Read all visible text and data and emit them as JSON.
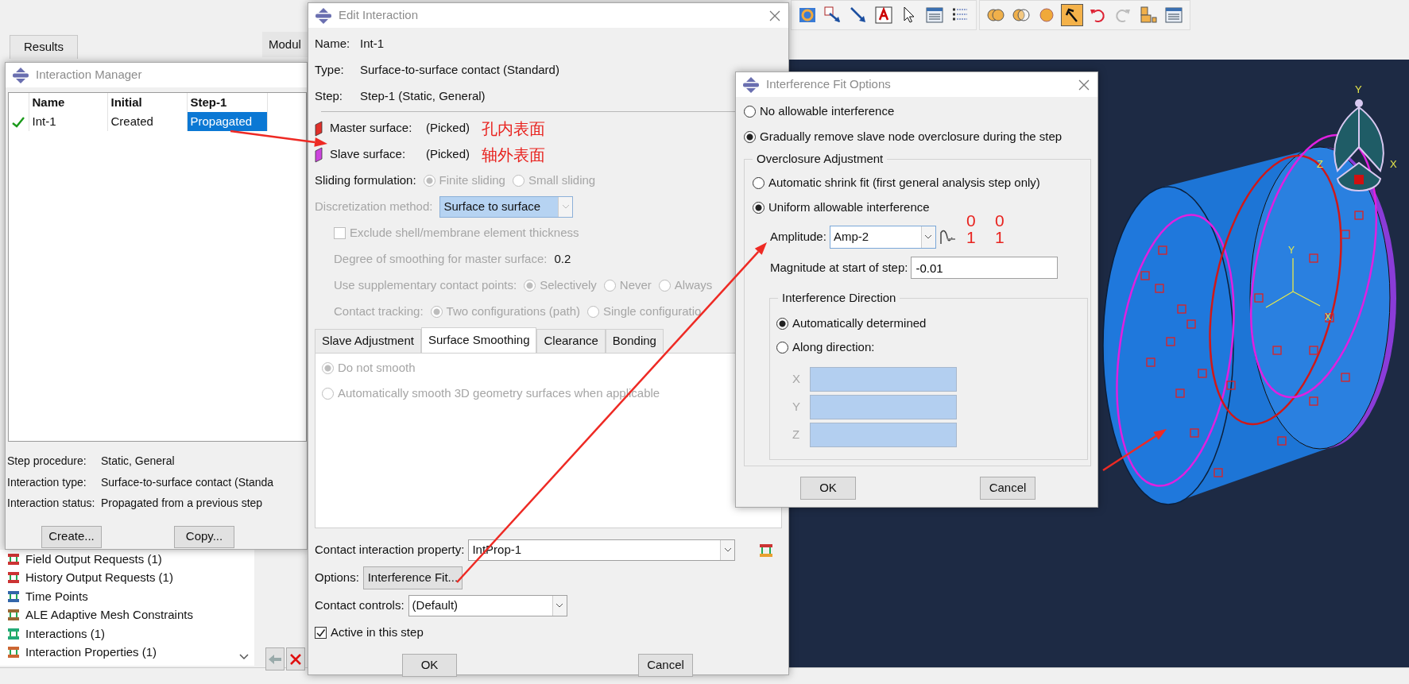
{
  "workspace": {
    "tabs": [
      {
        "label": "Results",
        "selected": false
      }
    ],
    "module_label": "Modul"
  },
  "toolbar": {
    "groups": [
      {
        "tools": [
          {
            "kind": "ring",
            "pressed": false
          },
          {
            "kind": "text-arrow",
            "pressed": false
          },
          {
            "kind": "arrow",
            "pressed": false
          },
          {
            "kind": "text-box",
            "pressed": false
          },
          {
            "kind": "pointer",
            "pressed": false
          },
          {
            "kind": "table",
            "pressed": false
          },
          {
            "kind": "list",
            "pressed": false
          }
        ]
      },
      {
        "tools": [
          {
            "kind": "union",
            "pressed": false
          },
          {
            "kind": "intersect",
            "pressed": false
          },
          {
            "kind": "sphere",
            "pressed": false
          },
          {
            "kind": "pick",
            "pressed": true
          },
          {
            "kind": "undo",
            "pressed": false
          },
          {
            "kind": "redo",
            "pressed": false
          },
          {
            "kind": "blocks",
            "pressed": false
          },
          {
            "kind": "table",
            "pressed": false
          }
        ]
      }
    ]
  },
  "interaction_manager": {
    "title": "Interaction Manager",
    "columns": [
      "Name",
      "Initial",
      "Step-1"
    ],
    "rows": [
      {
        "valid": true,
        "cells": [
          {
            "text": "Int-1",
            "selected": false
          },
          {
            "text": "Created",
            "selected": false
          },
          {
            "text": "Propagated",
            "selected": true
          }
        ]
      }
    ],
    "details": [
      {
        "label": "Step procedure:",
        "value": "Static, General"
      },
      {
        "label": "Interaction type:",
        "value": "Surface-to-surface contact (Standa"
      },
      {
        "label": "Interaction status:",
        "value": "Propagated from a previous step"
      }
    ],
    "buttons": [
      "Create...",
      "Copy..."
    ]
  },
  "model_tree": {
    "items": [
      {
        "kind": "field-output",
        "label": "Field Output Requests (1)"
      },
      {
        "kind": "history-output",
        "label": "History Output Requests (1)"
      },
      {
        "kind": "time-points",
        "label": "Time Points"
      },
      {
        "kind": "ale",
        "label": "ALE Adaptive Mesh Constraints"
      },
      {
        "kind": "interactions",
        "label": "Interactions (1)"
      },
      {
        "kind": "interaction-properties",
        "label": "Interaction Properties (1)"
      }
    ]
  },
  "edit_interaction": {
    "title": "Edit Interaction",
    "info": [
      {
        "label": "Name:",
        "value": "Int-1"
      },
      {
        "label": "Type:",
        "value": "Surface-to-surface contact (Standard)"
      },
      {
        "label": "Step:",
        "value": "Step-1 (Static, General)"
      }
    ],
    "surfaces": [
      {
        "label": "Master surface:",
        "value": "(Picked)",
        "color": "#e0302a",
        "note": "孔内表面"
      },
      {
        "label": "Slave surface:",
        "value": "(Picked)",
        "color": "#cc44dd",
        "note": "轴外表面"
      }
    ],
    "settings": [
      {
        "kind": "radio",
        "label": "Sliding formulation:",
        "disabled": false,
        "options": [
          {
            "label": "Finite sliding",
            "selected": true,
            "disabled": true
          },
          {
            "label": "Small sliding",
            "selected": false,
            "disabled": true
          }
        ]
      },
      {
        "kind": "select",
        "label": "Discretization method:",
        "disabled": true,
        "value": "Surface to surface",
        "children": [
          {
            "kind": "checkbox",
            "label": "Exclude shell/membrane element thickness",
            "checked": false,
            "disabled": true
          },
          {
            "kind": "value",
            "label": "Degree of smoothing for master surface:",
            "value": "0.2",
            "disabled": true
          },
          {
            "kind": "radio",
            "label": "Use supplementary contact points:",
            "disabled": true,
            "options": [
              {
                "label": "Selectively",
                "selected": true,
                "disabled": true
              },
              {
                "label": "Never",
                "selected": false,
                "disabled": true
              },
              {
                "label": "Always",
                "selected": false,
                "disabled": true
              }
            ]
          },
          {
            "kind": "radio",
            "label": "Contact tracking:",
            "disabled": true,
            "options": [
              {
                "label": "Two configurations (path)",
                "selected": true,
                "disabled": true
              },
              {
                "label": "Single configuratio",
                "selected": false,
                "disabled": true
              }
            ]
          }
        ]
      }
    ],
    "tabs": [
      {
        "label": "Slave Adjustment",
        "selected": false
      },
      {
        "label": "Surface Smoothing",
        "selected": true
      },
      {
        "label": "Clearance",
        "selected": false
      },
      {
        "label": "Bonding",
        "selected": false
      }
    ],
    "tab_options": [
      {
        "label": "Do not smooth",
        "selected": true,
        "disabled": true
      },
      {
        "label": "Automatically smooth 3D geometry surfaces when applicable",
        "selected": false,
        "disabled": true
      }
    ],
    "property": {
      "label": "Contact interaction property:",
      "value": "IntProp-1"
    },
    "options": {
      "label": "Options:",
      "button": "Interference Fit..."
    },
    "controls": {
      "label": "Contact controls:",
      "value": "(Default)"
    },
    "active": {
      "label": "Active in this step",
      "checked": true
    },
    "buttons": [
      "OK",
      "Cancel"
    ]
  },
  "interference_fit": {
    "title": "Interference Fit Options",
    "modes": [
      {
        "label": "No allowable interference",
        "selected": false
      },
      {
        "label": "Gradually remove slave node overclosure during the step",
        "selected": true
      }
    ],
    "overclosure": {
      "title": "Overclosure Adjustment",
      "methods": [
        {
          "label": "Automatic shrink fit (first general analysis step only)",
          "selected": false
        },
        {
          "label": "Uniform allowable interference",
          "selected": true
        }
      ],
      "amplitude": {
        "label": "Amplitude:",
        "value": "Amp-2"
      },
      "marks": [
        "0",
        "0",
        "1",
        "1"
      ],
      "magnitude": {
        "label": "Magnitude at start of step:",
        "value": "-0.01"
      },
      "direction": {
        "title": "Interference Direction",
        "options": [
          {
            "label": "Automatically determined",
            "selected": true
          },
          {
            "label": "Along direction:",
            "selected": false
          }
        ],
        "components": [
          {
            "label": "X",
            "disabled": true
          },
          {
            "label": "Y",
            "disabled": true
          },
          {
            "label": "Z",
            "disabled": true
          }
        ]
      }
    },
    "buttons": [
      "OK",
      "Cancel"
    ]
  },
  "viewport": {
    "triad": [
      "Y",
      "Z",
      "X"
    ],
    "axes": [
      "Y",
      "X"
    ]
  }
}
